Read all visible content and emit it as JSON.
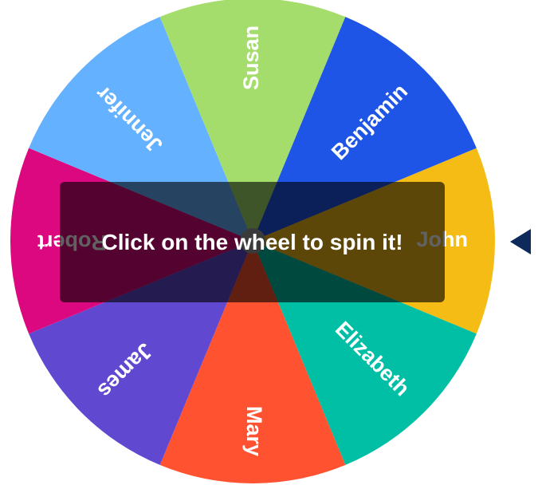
{
  "wheel": {
    "overlay_message": "Click on the wheel to spin it!",
    "pointer_color": "#0d2a5a",
    "segments": [
      {
        "name": "John",
        "color": "#F5BC16"
      },
      {
        "name": "Elizabeth",
        "color": "#00BFA5"
      },
      {
        "name": "Mary",
        "color": "#FF5230"
      },
      {
        "name": "James",
        "color": "#6048D1"
      },
      {
        "name": "Robert",
        "color": "#DC0880"
      },
      {
        "name": "Jennifer",
        "color": "#64B1FF"
      },
      {
        "name": "Susan",
        "color": "#A4DD6C"
      },
      {
        "name": "Benjamin",
        "color": "#1E55E6"
      }
    ],
    "hub_color": "#9a9a9a"
  }
}
